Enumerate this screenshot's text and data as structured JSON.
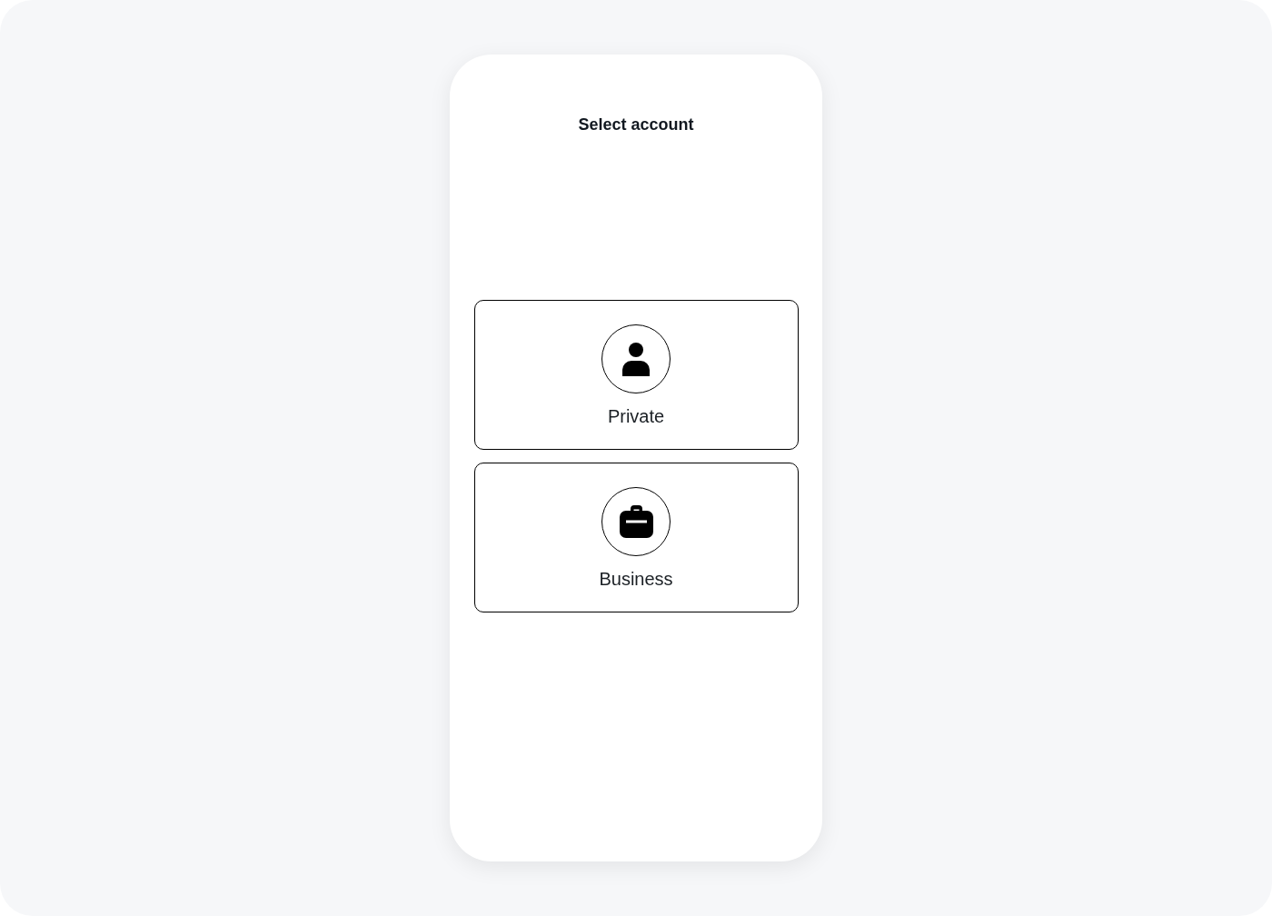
{
  "screen": {
    "title": "Select account"
  },
  "accounts": [
    {
      "kind": "person",
      "label": "Private",
      "selected": false
    },
    {
      "kind": "briefcase",
      "label": "Business",
      "selected": false
    }
  ]
}
